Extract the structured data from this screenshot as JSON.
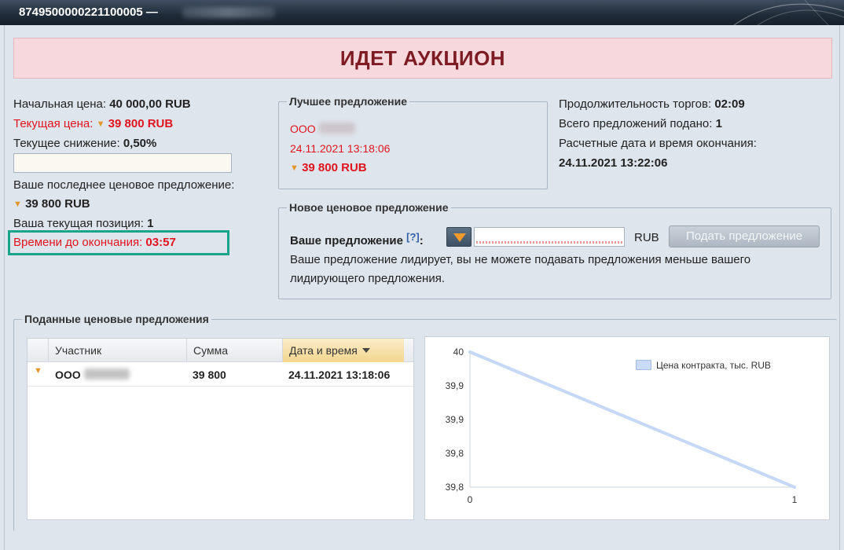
{
  "window": {
    "title": "8749500000221100005 —"
  },
  "status_banner": "ИДЕТ АУКЦИОН",
  "price_info": {
    "start_price_label": "Начальная цена:",
    "start_price_value": "40 000,00 RUB",
    "current_price_label": "Текущая цена:",
    "current_price_value": "39 800 RUB",
    "current_decrease_label": "Текущее снижение:",
    "current_decrease_value": "0,50%",
    "last_offer_label": "Ваше последнее ценовое предложение:",
    "last_offer_value": "39 800 RUB",
    "position_label": "Ваша текущая позиция:",
    "position_value": "1",
    "time_left_label": "Времени до окончания:",
    "time_left_value": "03:57"
  },
  "best_offer": {
    "legend": "Лучшее предложение",
    "company": "ООО",
    "datetime": "24.11.2021 13:18:06",
    "price": "39 800 RUB"
  },
  "auction_stats": {
    "duration_label": "Продолжительность торгов:",
    "duration_value": "02:09",
    "offers_count_label": "Всего предложений подано:",
    "offers_count_value": "1",
    "end_label": "Расчетные дата и время окончания:",
    "end_value": "24.11.2021 13:22:06"
  },
  "new_offer": {
    "legend": "Новое ценовое предложение",
    "your_offer_label": "Ваше предложение",
    "help_link": "[?]",
    "separator": ":",
    "input_value": "",
    "currency": "RUB",
    "submit_label": "Подать предложение",
    "info_line1": "Ваше предложение лидирует, вы не можете подавать предложения меньше вашего",
    "info_line2": "лидирующего предложения."
  },
  "submitted_offers": {
    "legend": "Поданные ценовые предложения",
    "columns": [
      "Участник",
      "Сумма",
      "Дата и время"
    ],
    "rows": [
      {
        "participant": "ООО",
        "amount": "39 800",
        "datetime": "24.11.2021 13:18:06"
      }
    ]
  },
  "chart_data": {
    "type": "line",
    "series": [
      {
        "name": "Цена контракта, тыс. RUB",
        "x": [
          0,
          1
        ],
        "values": [
          40,
          39.8
        ]
      }
    ],
    "x_ticks": [
      "0",
      "1"
    ],
    "y_ticks": [
      "40",
      "39,9",
      "39,9",
      "39,8",
      "39,8"
    ],
    "xlim": [
      0,
      1
    ],
    "ylim": [
      39.8,
      40
    ],
    "legend_position": "top-right",
    "series_color": "#c5d8f5"
  }
}
